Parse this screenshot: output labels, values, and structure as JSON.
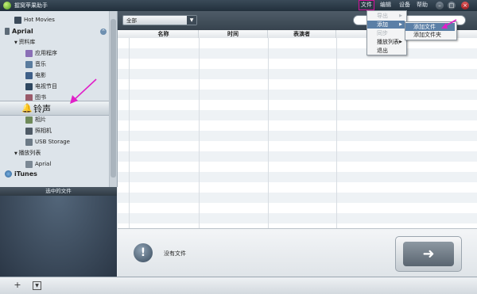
{
  "titlebar": {
    "app_title": "握窝苹果助手",
    "menus": [
      "文件",
      "编辑",
      "设备",
      "帮助"
    ]
  },
  "sidebar": {
    "hot_movies": "Hot Movies",
    "device": "Aprial",
    "library": "资料库",
    "items": [
      "应用程序",
      "音乐",
      "电影",
      "电视节目",
      "图书",
      "铃声",
      "相片",
      "照相机",
      "USB Storage"
    ],
    "playlists": "播放列表",
    "playlist_item": "Aprial",
    "itunes": "iTunes",
    "selected_files_header": "选中的文件"
  },
  "toolbar": {
    "filter_value": "全部"
  },
  "table": {
    "columns": [
      "名称",
      "时间",
      "表演者"
    ]
  },
  "bottom": {
    "status": "没有文件"
  },
  "file_menu": {
    "items": [
      "导出",
      "添加",
      "同步",
      "播放列表",
      "退出"
    ]
  },
  "add_submenu": {
    "items": [
      "添加文件",
      "添加文件夹"
    ]
  },
  "colors": {
    "accent": "#d0149a",
    "highlight": "#5b7fa6"
  }
}
